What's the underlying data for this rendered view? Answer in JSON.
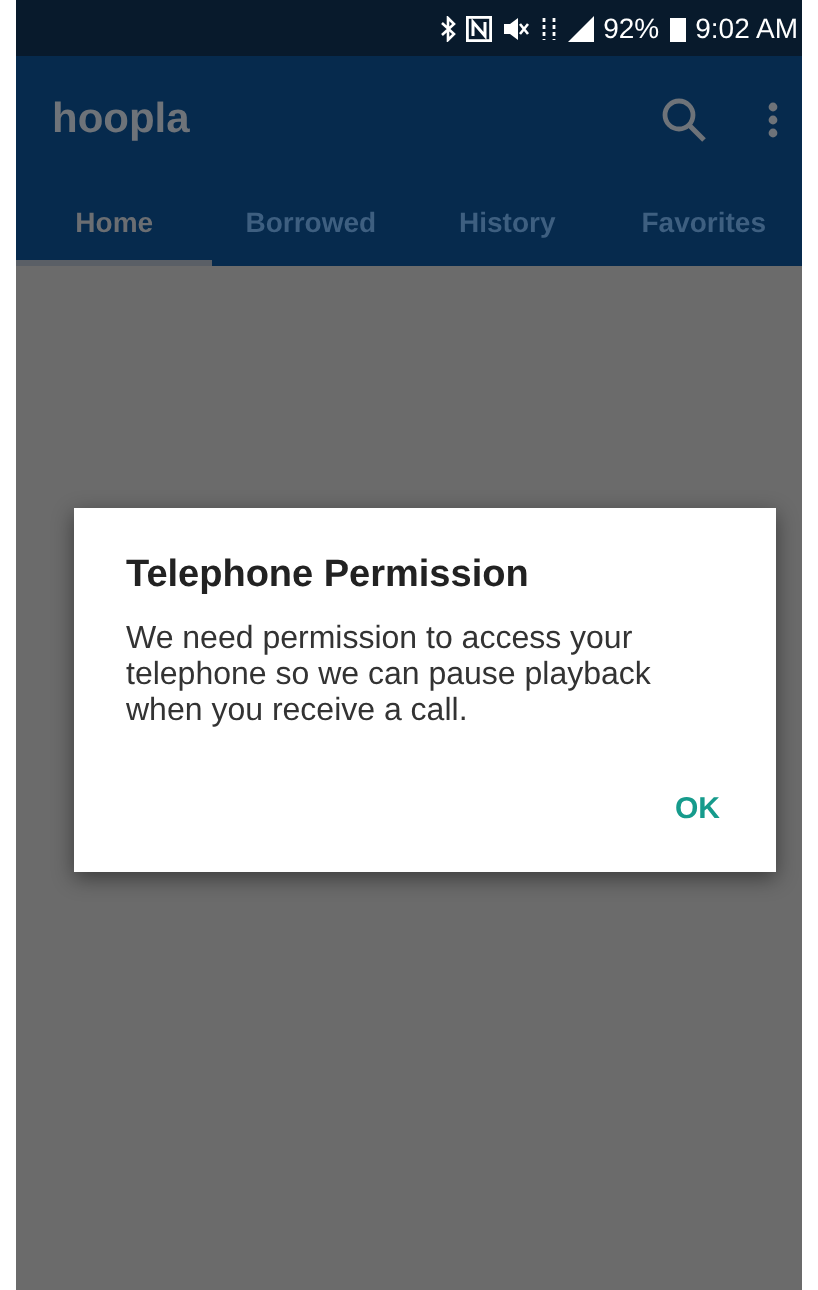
{
  "status_bar": {
    "battery": "92%",
    "time": "9:02 AM"
  },
  "app_bar": {
    "title": "hoopla"
  },
  "tabs": [
    {
      "label": "Home",
      "selected": true
    },
    {
      "label": "Borrowed",
      "selected": false
    },
    {
      "label": "History",
      "selected": false
    },
    {
      "label": "Favorites",
      "selected": false
    }
  ],
  "dialog": {
    "title": "Telephone Permission",
    "message": "We need permission to access your telephone so we can pause playback when you receive a call.",
    "buttons": [
      "OK"
    ]
  }
}
